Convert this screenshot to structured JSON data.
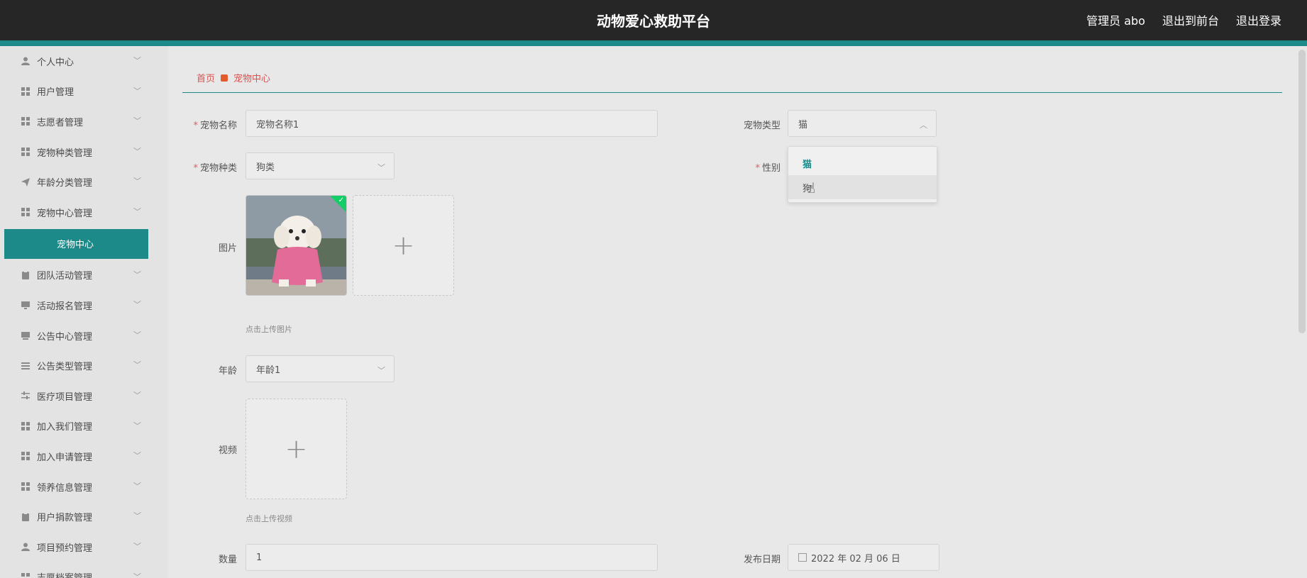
{
  "header": {
    "title": "动物爱心救助平台",
    "user": "管理员 abo",
    "front_link": "退出到前台",
    "logout_link": "退出登录"
  },
  "sidebar": {
    "items": [
      {
        "label": "个人中心",
        "icon": "user-icon"
      },
      {
        "label": "用户管理",
        "icon": "grid-icon"
      },
      {
        "label": "志愿者管理",
        "icon": "grid-icon"
      },
      {
        "label": "宠物种类管理",
        "icon": "grid-icon"
      },
      {
        "label": "年龄分类管理",
        "icon": "send-icon"
      },
      {
        "label": "宠物中心管理",
        "icon": "grid-icon"
      },
      {
        "label": "团队活动管理",
        "icon": "clipboard-icon"
      },
      {
        "label": "活动报名管理",
        "icon": "monitor-icon"
      },
      {
        "label": "公告中心管理",
        "icon": "monitor-icon"
      },
      {
        "label": "公告类型管理",
        "icon": "list-icon"
      },
      {
        "label": "医疗项目管理",
        "icon": "sliders-icon"
      },
      {
        "label": "加入我们管理",
        "icon": "grid-icon"
      },
      {
        "label": "加入申请管理",
        "icon": "grid-icon"
      },
      {
        "label": "领养信息管理",
        "icon": "grid-icon"
      },
      {
        "label": "用户捐款管理",
        "icon": "clipboard-icon"
      },
      {
        "label": "项目预约管理",
        "icon": "user-icon"
      },
      {
        "label": "志愿档案管理",
        "icon": "grid-icon"
      }
    ],
    "active_sub": "宠物中心"
  },
  "breadcrumb": {
    "home": "首页",
    "current": "宠物中心"
  },
  "form": {
    "pet_name_label": "宠物名称",
    "pet_name_value": "宠物名称1",
    "pet_type_label": "宠物类型",
    "pet_type_value": "猫",
    "pet_species_label": "宠物种类",
    "pet_species_value": "狗类",
    "gender_label": "性别",
    "image_label": "图片",
    "image_hint": "点击上传图片",
    "age_label": "年龄",
    "age_value": "年龄1",
    "video_label": "视频",
    "video_hint": "点击上传视频",
    "quantity_label": "数量",
    "quantity_value": "1",
    "publish_date_label": "发布日期",
    "publish_date_value": "2022 年 02 月 06 日"
  },
  "dropdown": {
    "options": [
      "猫",
      "狗"
    ],
    "selected": "猫",
    "hovered": "狗"
  },
  "colors": {
    "accent": "#1d8a8a",
    "header": "#262626",
    "breadcrumb": "#d9534f"
  }
}
